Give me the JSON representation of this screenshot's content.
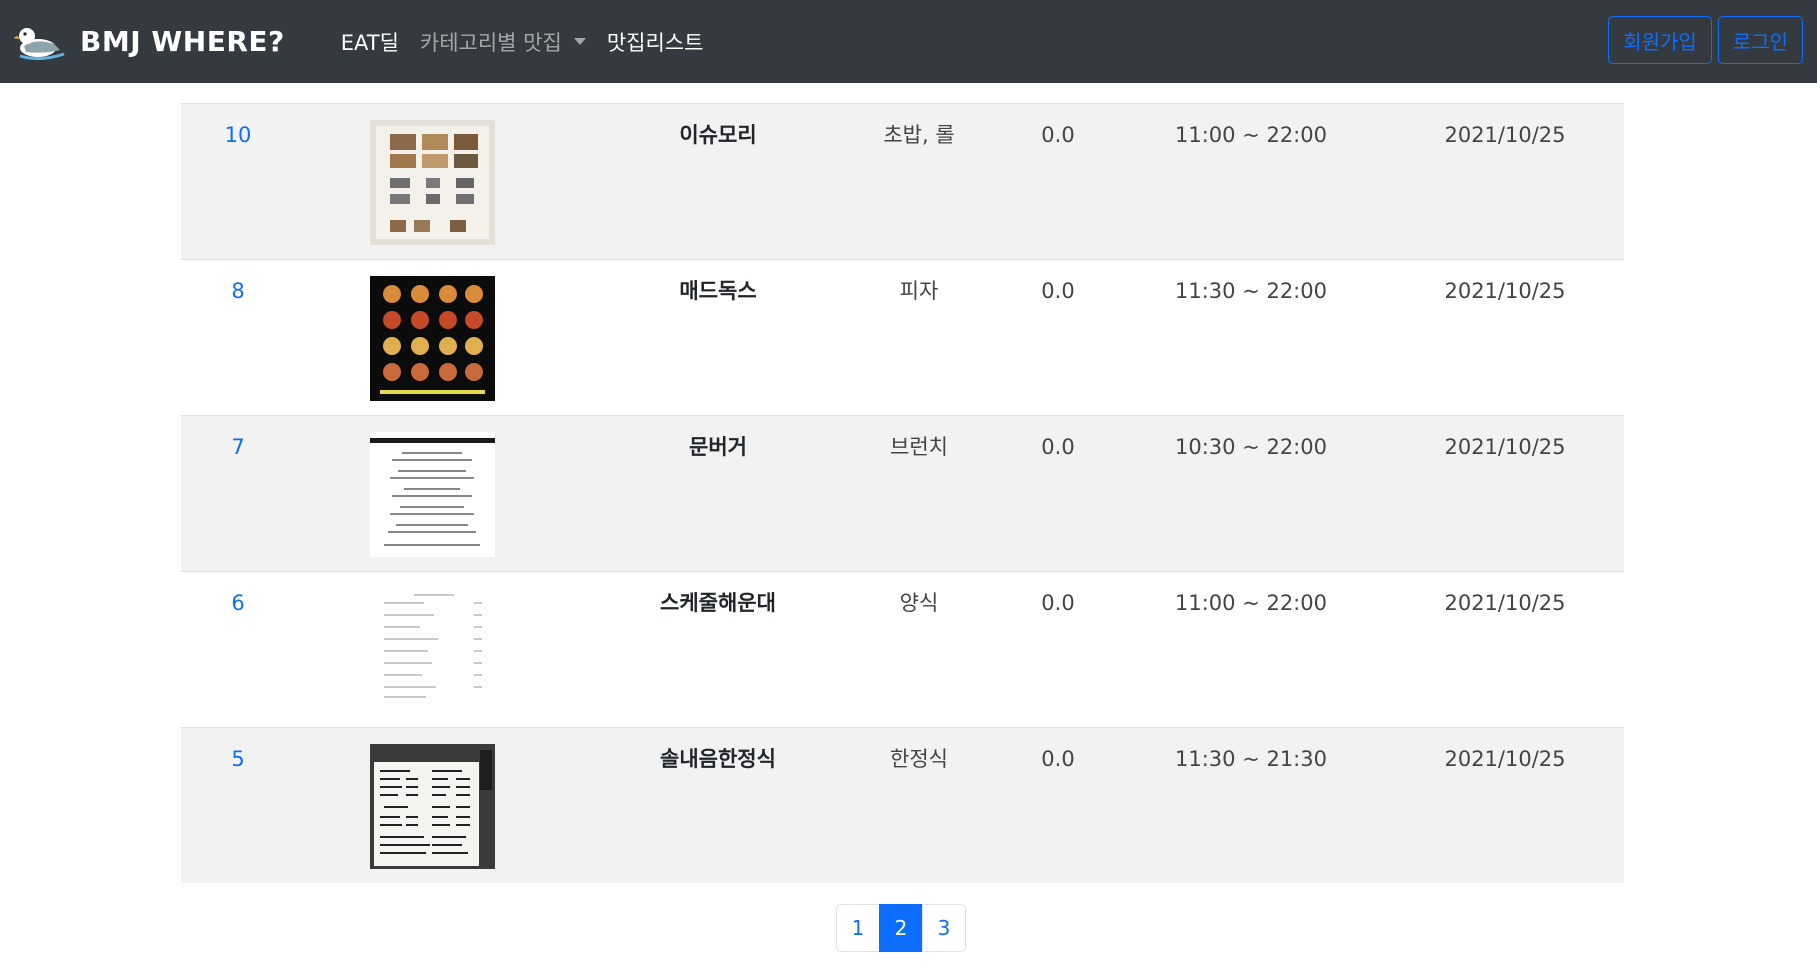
{
  "navbar": {
    "brand": "BMJ WHERE?",
    "links": [
      {
        "label": "EAT딜",
        "active": true
      },
      {
        "label": "카테고리별 맛집",
        "active": false,
        "dropdown": true
      },
      {
        "label": "맛집리스트",
        "active": true
      }
    ],
    "signup_label": "회원가입",
    "login_label": "로그인"
  },
  "restaurants": [
    {
      "no": "10",
      "name": "이슈모리",
      "category": "초밥, 롤",
      "rating": "0.0",
      "hours": "11:00 ~ 22:00",
      "date": "2021/10/25",
      "thumb": "menu-photo"
    },
    {
      "no": "8",
      "name": "매드독스",
      "category": "피자",
      "rating": "0.0",
      "hours": "11:30 ~ 22:00",
      "date": "2021/10/25",
      "thumb": "menu-dark"
    },
    {
      "no": "7",
      "name": "문버거",
      "category": "브런치",
      "rating": "0.0",
      "hours": "10:30 ~ 22:00",
      "date": "2021/10/25",
      "thumb": "menu-text"
    },
    {
      "no": "6",
      "name": "스케줄해운대",
      "category": "양식",
      "rating": "0.0",
      "hours": "11:00 ~ 22:00",
      "date": "2021/10/25",
      "thumb": "menu-light"
    },
    {
      "no": "5",
      "name": "솔내음한정식",
      "category": "한정식",
      "rating": "0.0",
      "hours": "11:30 ~ 21:30",
      "date": "2021/10/25",
      "thumb": "menu-board"
    }
  ],
  "pagination": {
    "pages": [
      "1",
      "2",
      "3"
    ],
    "current": "2"
  },
  "colors": {
    "navbar_bg": "#343a40",
    "accent": "#0d6efd",
    "striped_row": "#f2f2f2"
  }
}
